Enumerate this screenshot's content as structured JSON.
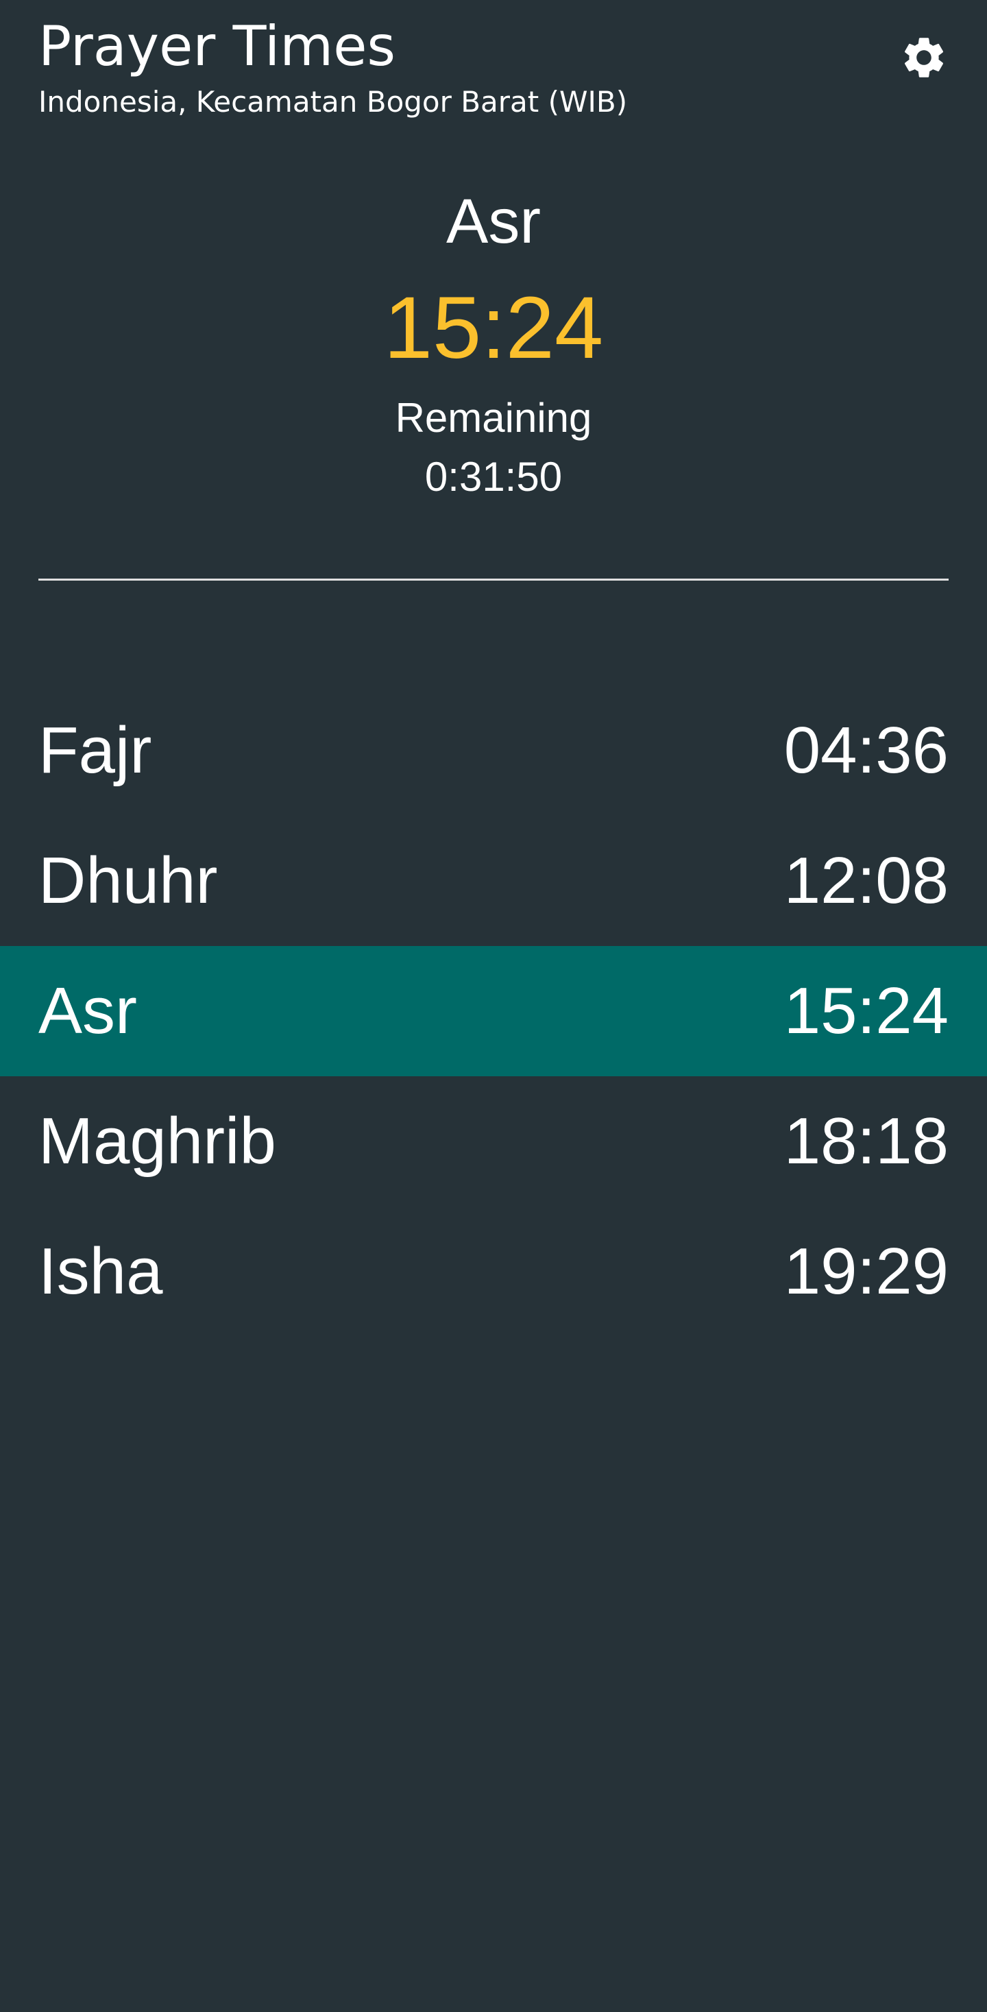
{
  "header": {
    "title": "Prayer Times",
    "location": "Indonesia, Kecamatan Bogor Barat (WIB)",
    "settings_icon": "gear-icon"
  },
  "current": {
    "name": "Asr",
    "time": "15:24",
    "remaining_label": "Remaining",
    "remaining_value": "0:31:50"
  },
  "prayers": [
    {
      "name": "Fajr",
      "time": "04:36"
    },
    {
      "name": "Dhuhr",
      "time": "12:08"
    },
    {
      "name": "Asr",
      "time": "15:24",
      "active": true
    },
    {
      "name": "Maghrib",
      "time": "18:18"
    },
    {
      "name": "Isha",
      "time": "19:29"
    }
  ],
  "colors": {
    "background": "#263238",
    "highlight": "#006a67",
    "accent": "#fbc02d",
    "text": "#ffffff"
  }
}
